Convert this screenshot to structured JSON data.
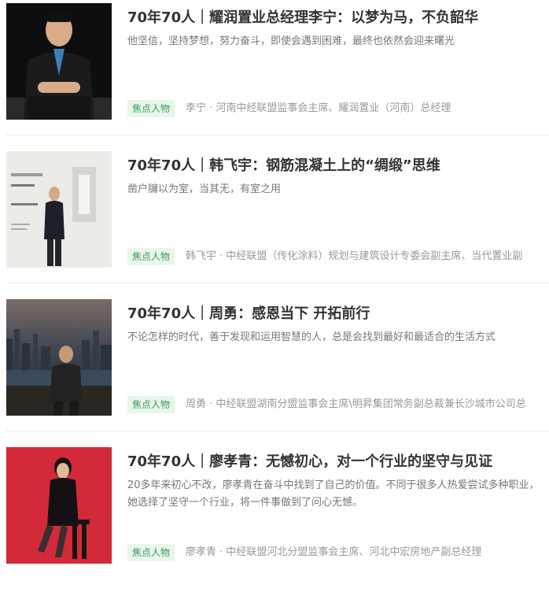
{
  "articles": [
    {
      "title": "70年70人｜耀润置业总经理李宁：以梦为马，不负韶华",
      "summary": "他坚信，坚持梦想，努力奋斗，即使会遇到困难，最终也依然会迎来曙光",
      "tag": "焦点人物",
      "byline": "李宁 · 河南中经联盟监事会主席、耀润置业（河南）总经理"
    },
    {
      "title": "70年70人｜韩飞宇：钢筋混凝土上的“绸缎”思维",
      "summary": "凿户牖以为室，当其无，有室之用",
      "tag": "焦点人物",
      "byline": "韩飞宇 · 中经联盟（传化涂料）规划与建筑设计专委会副主席、当代置业副"
    },
    {
      "title": "70年70人｜周勇：感恩当下 开拓前行",
      "summary": "不论怎样的时代，善于发现和运用智慧的人，总是会找到最好和最适合的生活方式",
      "tag": "焦点人物",
      "byline": "周勇 · 中经联盟湖南分盟监事会主席\\明昇集团常务副总裁兼长沙城市公司总"
    },
    {
      "title": "70年70人｜廖孝青：无憾初心，对一个行业的坚守与见证",
      "summary": "20多年来初心不改，廖孝青在奋斗中找到了自己的价值。不同于很多人热爱尝试多种职业，她选择了坚守一个行业，将一件事做到了问心无憾。",
      "tag": "焦点人物",
      "byline": "廖孝青 · 中经联盟河北分盟监事会主席、河北中宏房地产副总经理"
    }
  ]
}
